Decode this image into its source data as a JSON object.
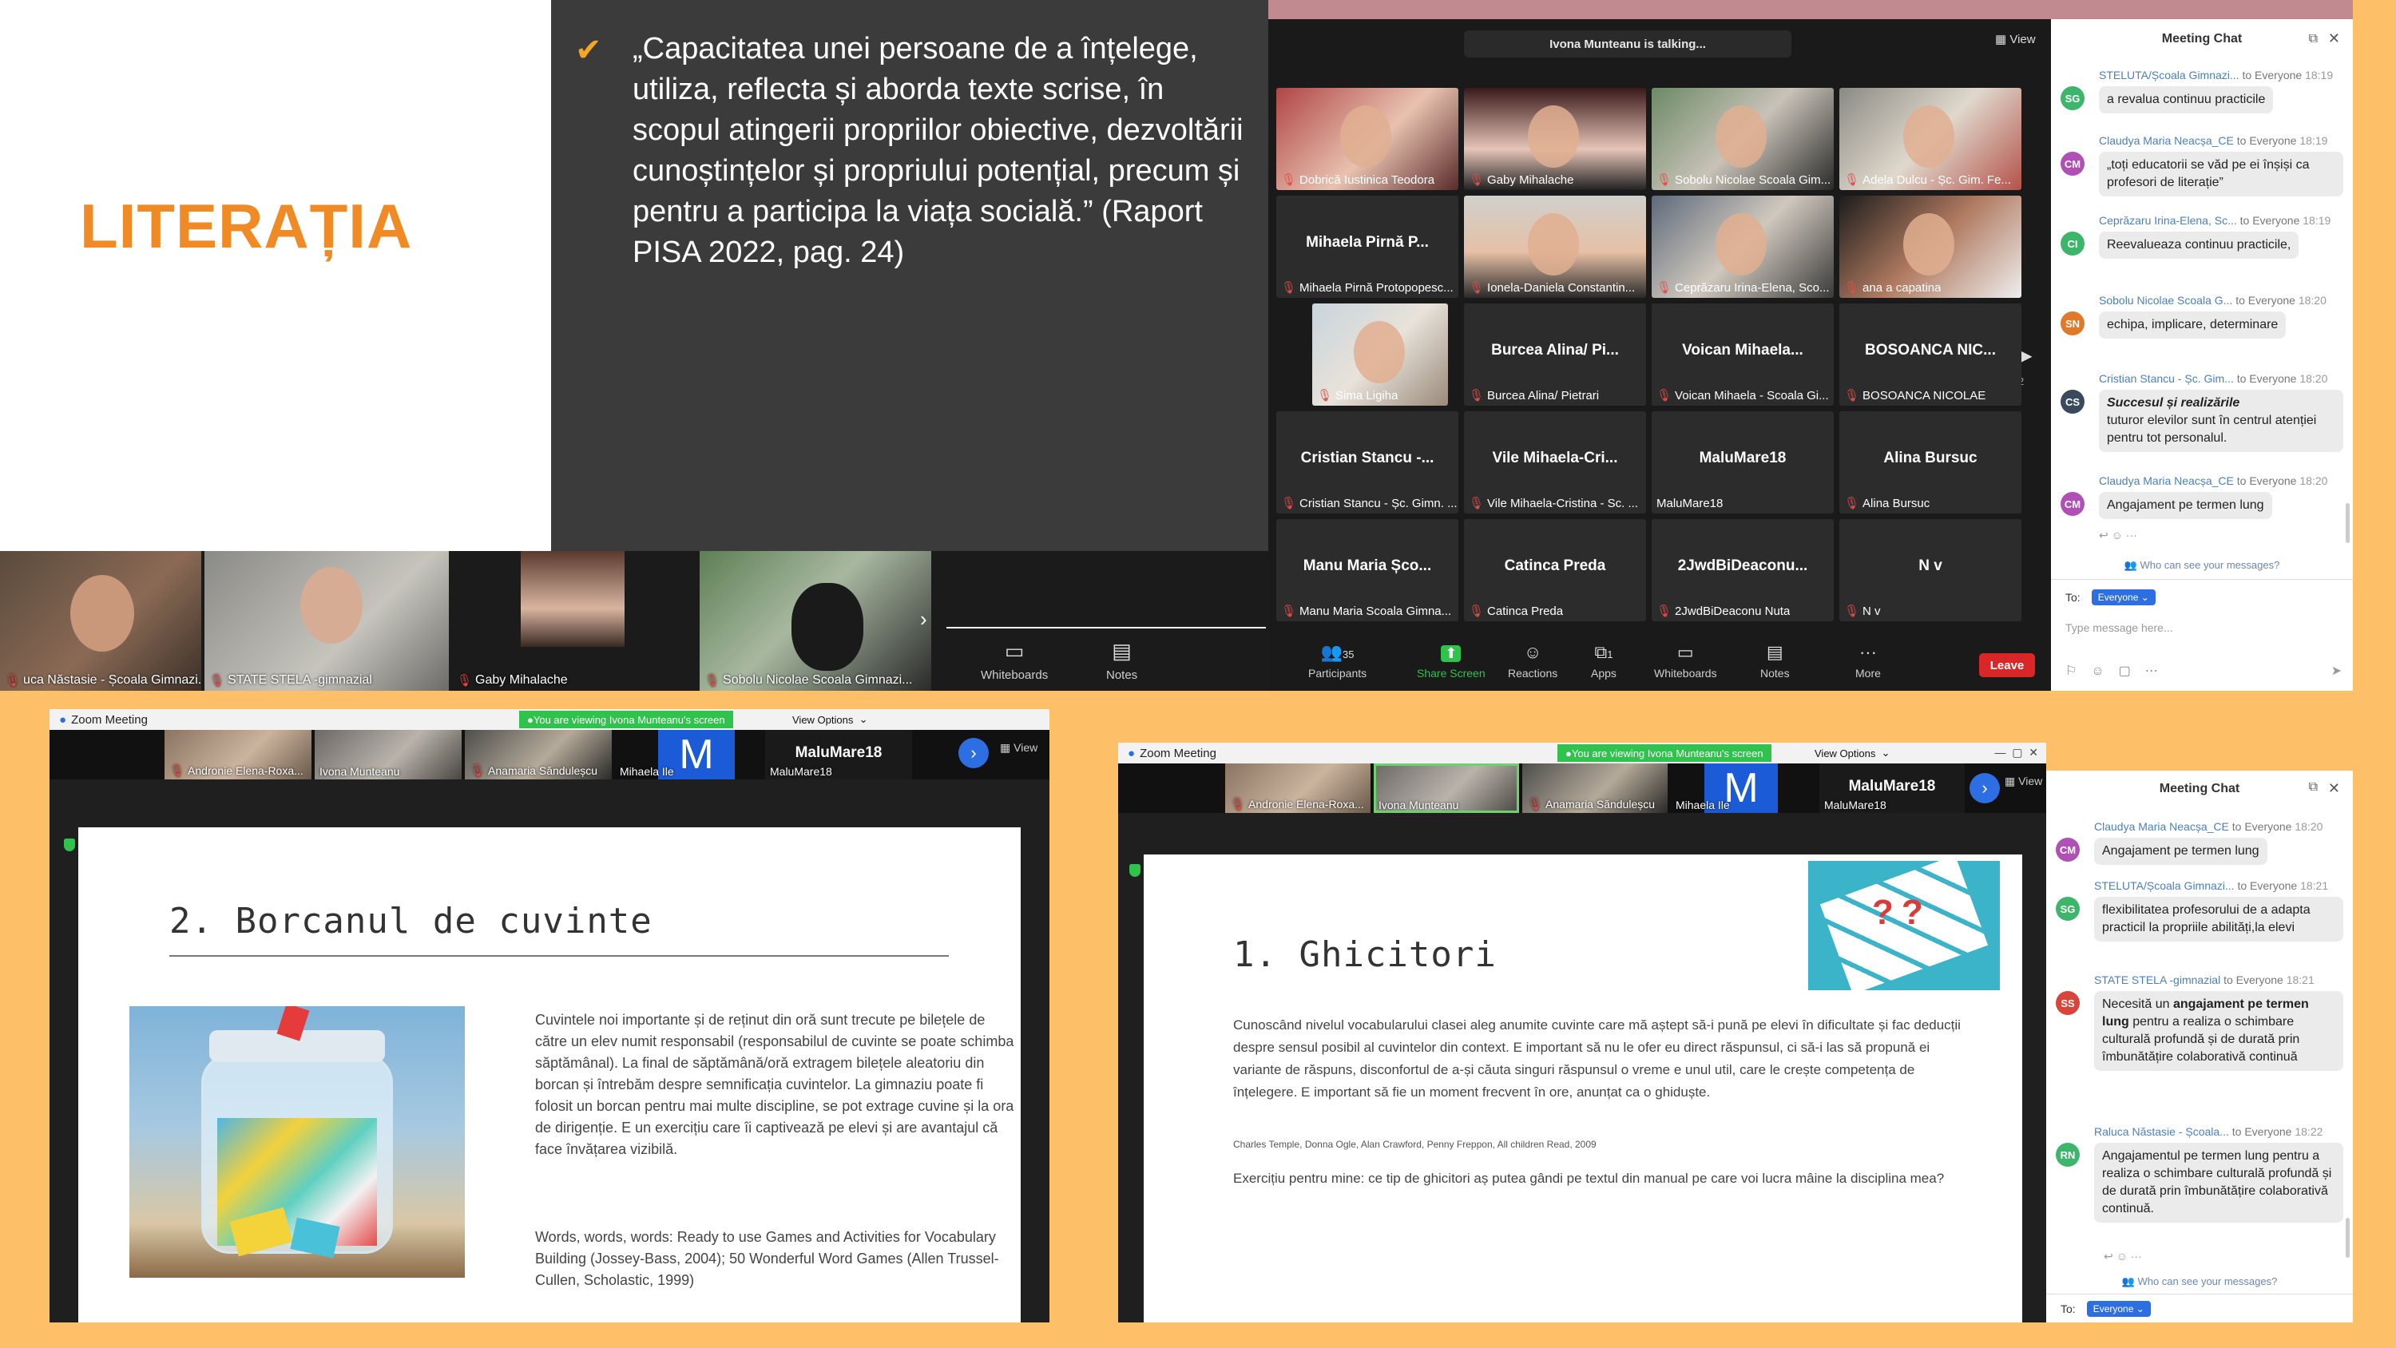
{
  "slide": {
    "title": "LITERAȚIA",
    "quote": "„Capacitatea unei persoane de a înțelege, utiliza, reflecta și aborda texte scrise, în scopul atingerii propriilor obiective, dezvoltării cunoștințelor și propriului potențial, precum și pentru a participa la viața socială.” (Raport PISA 2022, pag. 24)"
  },
  "strip1": [
    {
      "label": "uca Năstasie - Școala Gimnazi..."
    },
    {
      "label": "STATE STELA -gimnazial"
    },
    {
      "label": "Gaby Mihalache"
    },
    {
      "label": "Sobolu Nicolae Scoala Gimnazi..."
    }
  ],
  "toolbar1": {
    "whiteboards": "Whiteboards",
    "notes": "Notes"
  },
  "gallery": {
    "talking": "Ivona Munteanu is talking...",
    "view": "View",
    "page": "1/2",
    "tiles": [
      {
        "name": "",
        "label": "Dobrică Iustinica Teodora"
      },
      {
        "name": "",
        "label": "Gaby Mihalache"
      },
      {
        "name": "",
        "label": "Sobolu Nicolae Scoala Gim..."
      },
      {
        "name": "",
        "label": "Adela Dulcu - Șc. Gim. Fe..."
      },
      {
        "name": "Mihaela Pirnă P...",
        "label": "Mihaela Pirnă Protopopesc..."
      },
      {
        "name": "",
        "label": "Ionela-Daniela Constantin..."
      },
      {
        "name": "",
        "label": "Ceprăzaru Irina-Elena, Sco..."
      },
      {
        "name": "",
        "label": "ana a capatina"
      },
      {
        "name": "",
        "label": "Sima Ligiha"
      },
      {
        "name": "Burcea Alina/ Pi...",
        "label": "Burcea Alina/ Pietrari"
      },
      {
        "name": "Voican Mihaela...",
        "label": "Voican Mihaela - Scoala Gi..."
      },
      {
        "name": "BOSOANCA NIC...",
        "label": "BOSOANCA NICOLAE"
      },
      {
        "name": "Cristian Stancu -...",
        "label": "Cristian Stancu - Șc. Gimn. ..."
      },
      {
        "name": "Vile Mihaela-Cri...",
        "label": "Vile Mihaela-Cristina - Sc. ..."
      },
      {
        "name": "MaluMare18",
        "label": "MaluMare18"
      },
      {
        "name": "Alina Bursuc",
        "label": "Alina Bursuc"
      },
      {
        "name": "Manu Maria Șco...",
        "label": "Manu Maria Scoala Gimna..."
      },
      {
        "name": "Catinca Preda",
        "label": "Catinca Preda"
      },
      {
        "name": "2JwdBiDeaconu...",
        "label": "2JwdBiDeaconu Nuta"
      },
      {
        "name": "N v",
        "label": "N v"
      }
    ]
  },
  "zoombar": {
    "participants": "Participants",
    "participants_count": "35",
    "share": "Share Screen",
    "reactions": "Reactions",
    "apps": "Apps",
    "apps_count": "1",
    "whiteboards": "Whiteboards",
    "notes": "Notes",
    "more": "More",
    "leave": "Leave"
  },
  "chat1": {
    "title": "Meeting Chat",
    "messages": [
      {
        "initials": "SG",
        "color": "#3db56b",
        "sender": "STELUTA/Școala Gimnazi...",
        "to": "to Everyone",
        "time": "18:19",
        "text": "a revalua continuu practicile"
      },
      {
        "initials": "CM",
        "color": "#b04fb5",
        "sender": "Claudya Maria Neacșa_CE",
        "to": "to Everyone",
        "time": "18:19",
        "text": "„toți educatorii se văd pe ei înșiși ca profesori de literație”"
      },
      {
        "initials": "CI",
        "color": "#3db56b",
        "sender": "Ceprăzaru Irina-Elena, Sc...",
        "to": "to Everyone",
        "time": "18:19",
        "text": "Reevalueaza continuu practicile,"
      },
      {
        "initials": "SN",
        "color": "#e07a2a",
        "sender": "Sobolu Nicolae Scoala G...",
        "to": "to Everyone",
        "time": "18:20",
        "text": "echipa, implicare, determinare"
      },
      {
        "initials": "CS",
        "color": "#3a4a5c",
        "sender": "Cristian Stancu - Șc. Gim...",
        "to": "to Everyone",
        "time": "18:20",
        "title": "Succesul și realizările",
        "text": "tuturor elevilor sunt în centrul atenției pentru tot personalul."
      },
      {
        "initials": "CM",
        "color": "#b04fb5",
        "sender": "Claudya Maria Neacșa_CE",
        "to": "to Everyone",
        "time": "18:20",
        "text": "Angajament pe termen lung"
      }
    ],
    "who": "Who can see your messages?",
    "to_label": "To:",
    "to_value": "Everyone",
    "placeholder": "Type message here..."
  },
  "panel3": {
    "window_title": "Zoom Meeting",
    "viewing": "You are viewing Ivona Munteanu's screen",
    "view_options": "View Options",
    "view": "View",
    "tiles": [
      {
        "label": "Andronie Elena-Roxa..."
      },
      {
        "label": "Ivona Munteanu"
      },
      {
        "label": "Anamaria Sănduleșcu"
      },
      {
        "label": "Mihaela Ile",
        "letter": "M"
      },
      {
        "name": "MaluMare18",
        "label": "MaluMare18"
      }
    ],
    "doc_title": "2. Borcanul de cuvinte",
    "body": "Cuvintele noi importante și de reținut din oră sunt trecute pe bilețele de către un elev numit responsabil (responsabilul de cuvinte se poate schimba săptămânal). La final de săptămână/oră extragem bilețele aleatoriu din borcan și întrebăm despre semnificația cuvintelor. La gimnaziu poate fi folosit un borcan pentru mai multe discipline, se pot extrage cuvine și la ora de dirigenție. E un exercițiu care îi captivează pe elevi și are avantajul că face învățarea vizibilă.",
    "ref": "Words, words, words: Ready to use Games and Activities for Vocabulary Building (Jossey-Bass, 2004); 50 Wonderful Word Games (Allen Trussel-Cullen, Scholastic, 1999)"
  },
  "panel4": {
    "window_title": "Zoom Meeting",
    "viewing": "You are viewing Ivona Munteanu's screen",
    "view_options": "View Options",
    "view": "View",
    "tiles": [
      {
        "label": "Andronie Elena-Roxa..."
      },
      {
        "label": "Ivona Munteanu"
      },
      {
        "label": "Anamaria Sănduleșcu"
      },
      {
        "label": "Mihaela Ile",
        "letter": "M"
      },
      {
        "name": "MaluMare18",
        "label": "MaluMare18"
      }
    ],
    "doc_title": "1. Ghicitori",
    "body": "Cunoscând nivelul vocabularului clasei aleg anumite cuvinte care mă aștept să-i pună pe elevi în dificultate și fac deducții despre sensul posibil al cuvintelor din context. E important să nu le ofer eu direct răspunsul, ci să-i las să propună ei variante de răspuns, disconfortul de a-și căuta singuri răspunsul o vreme e unul util, care le crește competența de înțelegere. E important să fie un moment frecvent în ore, anunțat ca o ghiduște.",
    "citation": "Charles Temple, Donna Ogle, Alan Crawford, Penny Freppon, All children Read, 2009",
    "exercise": "Exercițiu pentru mine: ce tip de ghicitori aș putea gândi pe textul din manual pe care voi lucra mâine la disciplina mea?"
  },
  "chat2": {
    "title": "Meeting Chat",
    "messages": [
      {
        "initials": "CM",
        "color": "#b04fb5",
        "sender": "Claudya Maria Neacșa_CE",
        "to": "to Everyone",
        "time": "18:20",
        "text": "Angajament pe termen lung"
      },
      {
        "initials": "SG",
        "color": "#3db56b",
        "sender": "STELUTA/Școala Gimnazi...",
        "to": "to Everyone",
        "time": "18:21",
        "text": "flexibilitatea profesorului de a adapta practicil la propriile abilități,la elevi"
      },
      {
        "initials": "SS",
        "color": "#d9453b",
        "sender": "STATE STELA -gimnazial",
        "to": "to Everyone",
        "time": "18:21",
        "text_pre": "Necesită un ",
        "text_bold": "angajament pe termen lung",
        "text_post": " pentru a realiza o schimbare culturală profundă și de durată prin îmbunătățire colaborativă continuă"
      },
      {
        "initials": "RN",
        "color": "#3db56b",
        "sender": "Raluca Năstasie - Școala...",
        "to": "to Everyone",
        "time": "18:22",
        "text": "Angajamentul pe termen lung pentru a realiza o schimbare culturală profundă și de durată prin îmbunătățire colaborativă continuă."
      }
    ],
    "who": "Who can see your messages?",
    "to_label": "To:",
    "to_value": "Everyone"
  }
}
